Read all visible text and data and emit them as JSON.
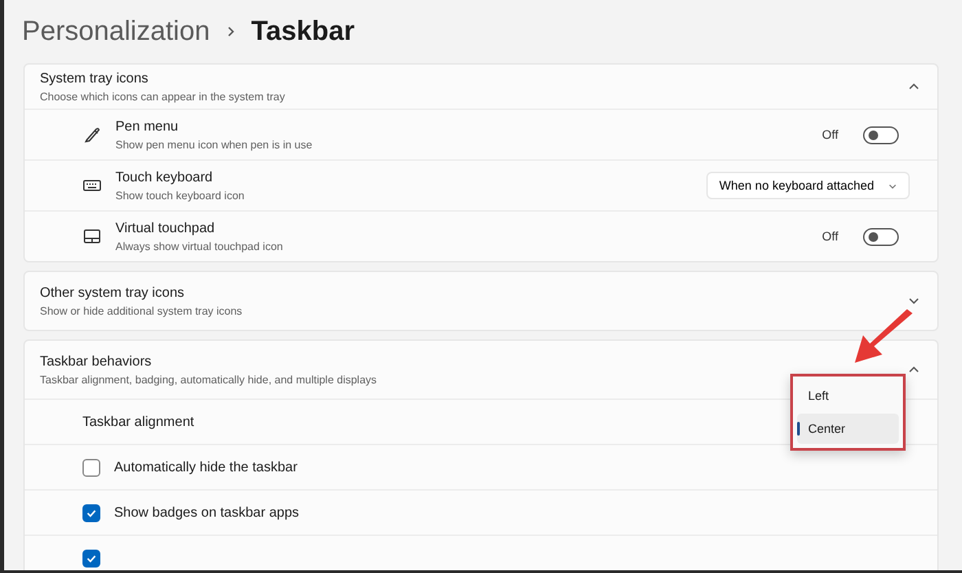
{
  "breadcrumb": [
    {
      "label": "Personalization",
      "current": false
    },
    {
      "label": "Taskbar",
      "current": true
    }
  ],
  "sections": [
    {
      "title": "System tray icons",
      "subtitle": "Choose which icons can appear in the system tray",
      "expanded": true,
      "rows": [
        {
          "kind": "toggle",
          "title": "Pen menu",
          "subtitle": "Show pen menu icon when pen is in use",
          "state_label": "Off",
          "on": false
        },
        {
          "kind": "dropdown",
          "title": "Touch keyboard",
          "subtitle": "Show touch keyboard icon",
          "value": "When no keyboard attached"
        },
        {
          "kind": "toggle",
          "title": "Virtual touchpad",
          "subtitle": "Always show virtual touchpad icon",
          "state_label": "Off",
          "on": false
        }
      ]
    },
    {
      "title": "Other system tray icons",
      "subtitle": "Show or hide additional system tray icons",
      "expanded": false
    },
    {
      "title": "Taskbar behaviors",
      "subtitle": "Taskbar alignment, badging, automatically hide, and multiple displays",
      "expanded": true,
      "rows": [
        {
          "kind": "label",
          "title": "Taskbar alignment"
        },
        {
          "kind": "checkbox",
          "title": "Automatically hide the taskbar",
          "checked": false
        },
        {
          "kind": "checkbox",
          "title": "Show badges on taskbar apps",
          "checked": true
        },
        {
          "kind": "checkbox",
          "checked": true
        }
      ]
    }
  ],
  "alignment_menu": {
    "options": [
      {
        "label": "Left",
        "selected": false
      },
      {
        "label": "Center",
        "selected": true
      }
    ]
  }
}
